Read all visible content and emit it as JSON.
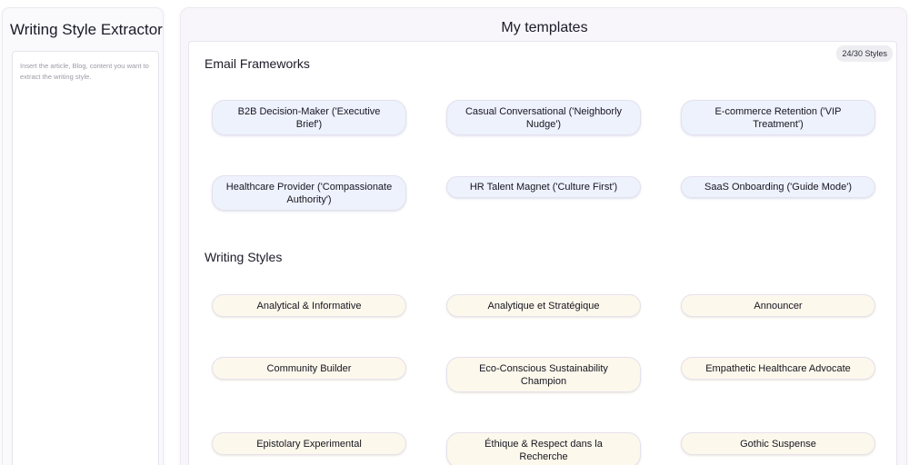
{
  "sidebar": {
    "title": "Writing Style Extractor",
    "input_placeholder": "Insert the article, Blog, content you want to extract the writing style."
  },
  "main": {
    "title": "My templates",
    "count_badge": "24/30 Styles",
    "sections": [
      {
        "heading": "Email Frameworks",
        "items": [
          "B2B Decision-Maker ('Executive Brief')",
          "Casual Conversational ('Neighborly Nudge')",
          "E-commerce Retention ('VIP Treatment')",
          "Healthcare Provider ('Compassionate Authority')",
          "HR Talent Magnet ('Culture First')",
          "SaaS Onboarding ('Guide Mode')"
        ]
      },
      {
        "heading": "Writing Styles",
        "items": [
          "Analytical & Informative",
          "Analytique et Stratégique",
          "Announcer",
          "Community Builder",
          "Eco-Conscious Sustainability Champion",
          "Empathetic Healthcare Advocate",
          "Epistolary Experimental",
          "Éthique & Respect dans la Recherche",
          "Gothic Suspense"
        ]
      }
    ]
  },
  "colors": {
    "email_chip_bg": "#eef2fc",
    "style_chip_bg": "#fdf8ec"
  }
}
